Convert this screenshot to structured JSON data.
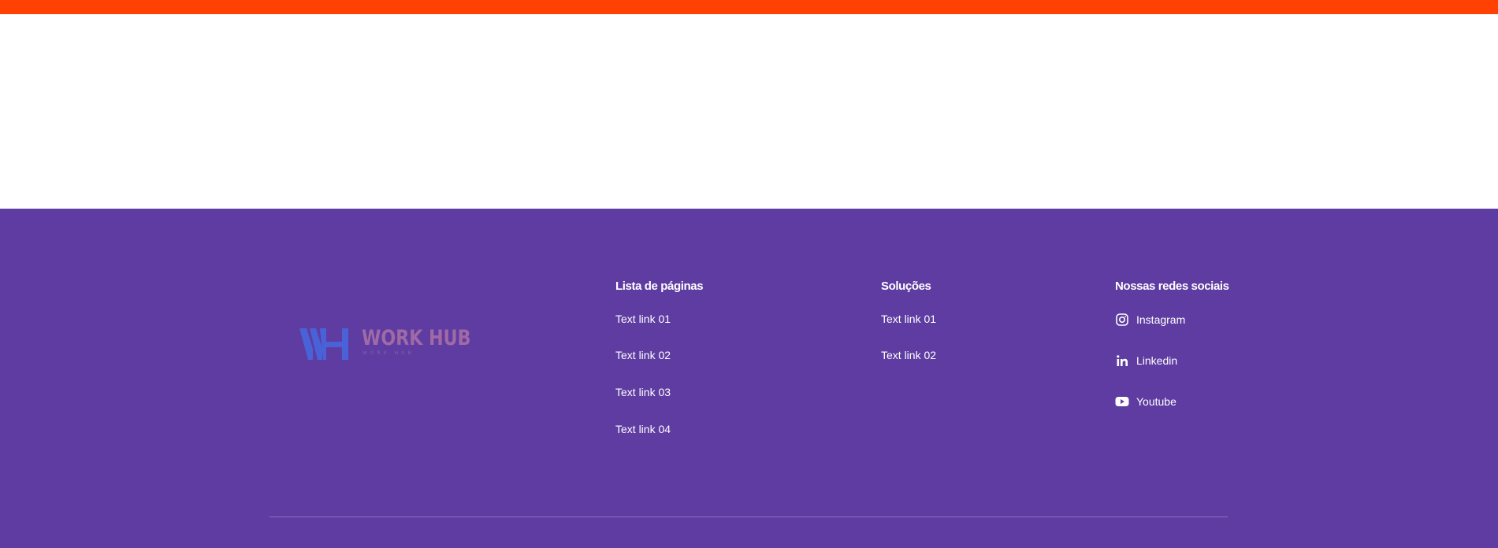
{
  "brand": {
    "logo_text": "WORK HUB",
    "logo_tagline": "WORK HUB",
    "colors": {
      "top_bar": "#ff4104",
      "footer_background": "#5e3ca1",
      "logo_mark": "#4a62d8",
      "logo_text": "#a06aa6"
    }
  },
  "footer": {
    "pages": {
      "title": "Lista de páginas",
      "links": [
        "Text link 01",
        "Text link 02",
        "Text link 03",
        "Text link 04"
      ]
    },
    "solutions": {
      "title": "Soluções",
      "links": [
        "Text link 01",
        "Text link 02"
      ]
    },
    "social": {
      "title": "Nossas redes sociais",
      "items": [
        {
          "label": "Instagram",
          "icon": "instagram-icon"
        },
        {
          "label": "Linkedin",
          "icon": "linkedin-icon"
        },
        {
          "label": "Youtube",
          "icon": "youtube-icon"
        }
      ]
    }
  }
}
